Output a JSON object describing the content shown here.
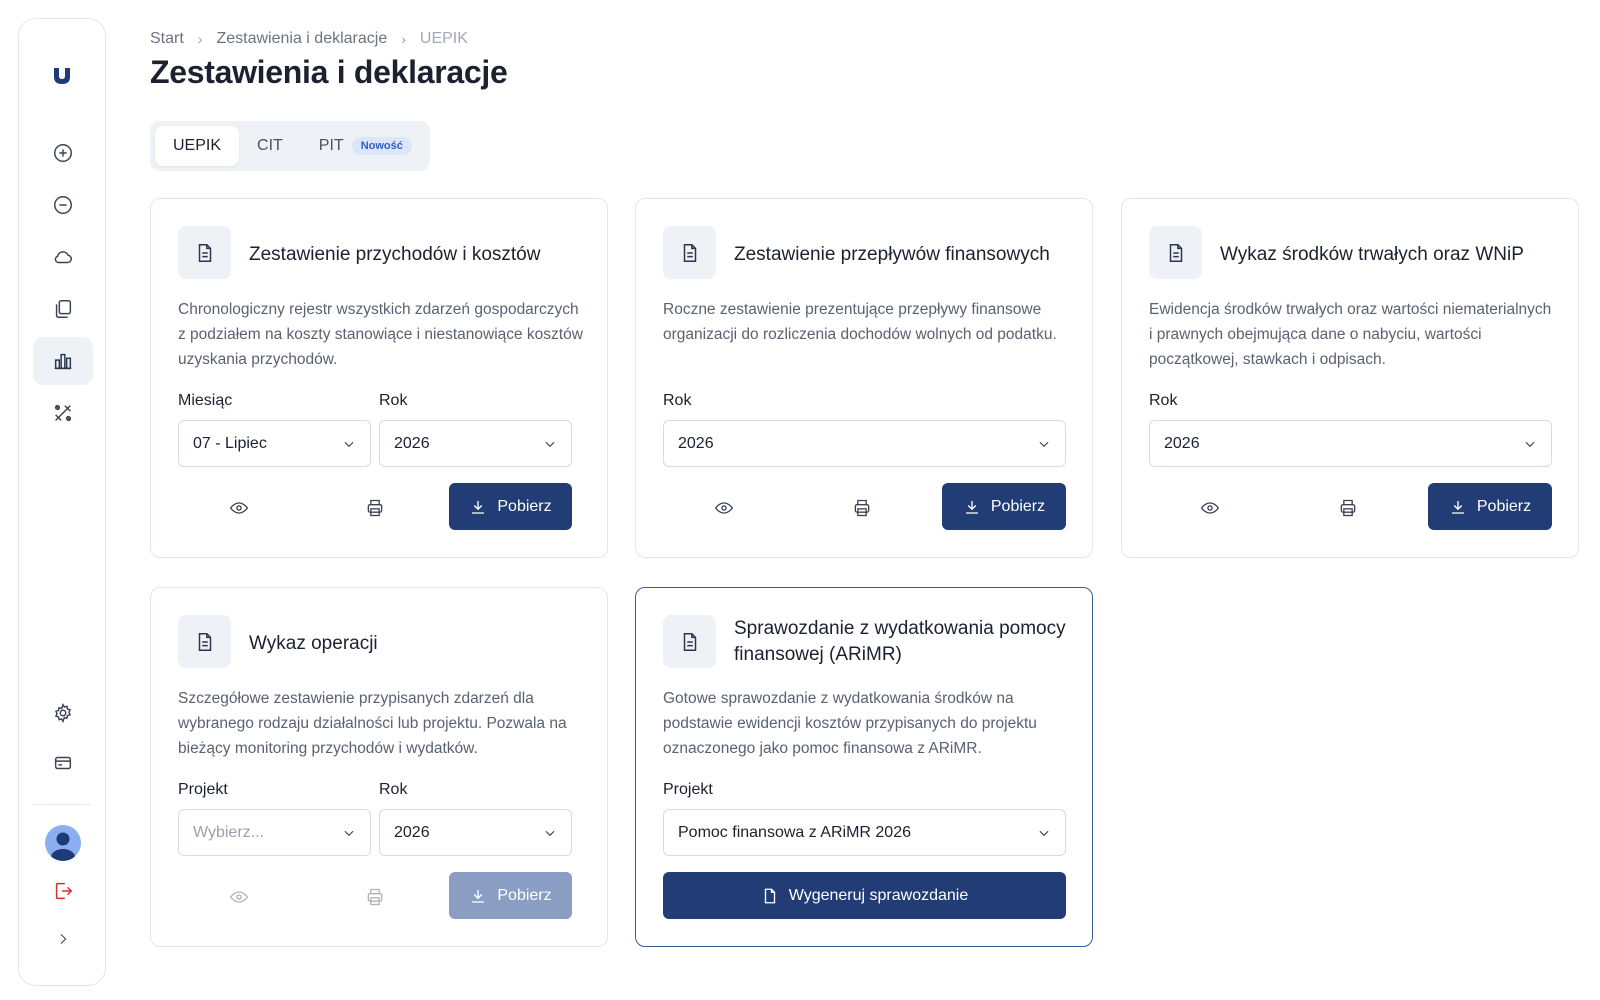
{
  "sidebar": {
    "items": [
      {
        "icon": "plus-circle-icon"
      },
      {
        "icon": "minus-circle-icon"
      },
      {
        "icon": "cloud-icon"
      },
      {
        "icon": "files-icon"
      },
      {
        "icon": "bar-chart-icon",
        "active": true
      },
      {
        "icon": "tools-icon"
      }
    ],
    "bottom": [
      {
        "icon": "gear-icon"
      },
      {
        "icon": "card-icon"
      },
      {
        "icon": "logout-icon"
      },
      {
        "icon": "chevron-right-icon"
      }
    ]
  },
  "breadcrumb": {
    "items": [
      "Start",
      "Zestawienia i deklaracje"
    ],
    "current": "UEPIK"
  },
  "page": {
    "title": "Zestawienia i deklaracje"
  },
  "tabs": [
    {
      "label": "UEPIK",
      "active": true
    },
    {
      "label": "CIT"
    },
    {
      "label": "PIT",
      "badge": "Nowość"
    }
  ],
  "cards": [
    {
      "title": "Zestawienie przychodów i kosztów",
      "description": "Chronologiczny rejestr wszystkich zdarzeń gospodarczych z podziałem na koszty stanowiące i niestanowiące kosztów uzyskania przychodów.",
      "month_label": "Miesiąc",
      "month_value": "07 - Lipiec",
      "year_label": "Rok",
      "year_value": "2026",
      "download_label": "Pobierz"
    },
    {
      "title": "Zestawienie przepływów finansowych",
      "description": "Roczne zestawienie prezentujące przepływy finansowe organizacji do rozliczenia dochodów wolnych od podatku.",
      "year_label": "Rok",
      "year_value": "2026",
      "download_label": "Pobierz"
    },
    {
      "title": "Wykaz środków trwałych oraz WNiP",
      "description": "Ewidencja środków trwałych oraz wartości niematerialnych i prawnych obejmująca dane o nabyciu, wartości początkowej, stawkach i odpisach.",
      "year_label": "Rok",
      "year_value": "2026",
      "download_label": "Pobierz"
    },
    {
      "title": "Wykaz operacji",
      "description": "Szczegółowe zestawienie przypisanych zdarzeń dla wybranego rodzaju działalności lub projektu. Pozwala na bieżący monitoring przychodów i wydatków.",
      "project_label": "Projekt",
      "project_placeholder": "Wybierz...",
      "year_label": "Rok",
      "year_value": "2026",
      "download_label": "Pobierz"
    },
    {
      "title": "Sprawozdanie z wydatkowania pomocy finansowej (ARiMR)",
      "description": "Gotowe sprawozdanie z wydatkowania środków na podstawie ewidencji kosztów przypisanych do projektu oznaczonego jako pomoc finansowa z ARiMR.",
      "project_label": "Projekt",
      "project_value": "Pomoc finansowa z ARiMR 2026",
      "generate_label": "Wygeneruj sprawozdanie"
    }
  ],
  "colors": {
    "primary": "#223d75",
    "primary_disabled": "#8a9ec4",
    "border": "#e3e6ec",
    "highlight_border": "#3a5a9a"
  }
}
